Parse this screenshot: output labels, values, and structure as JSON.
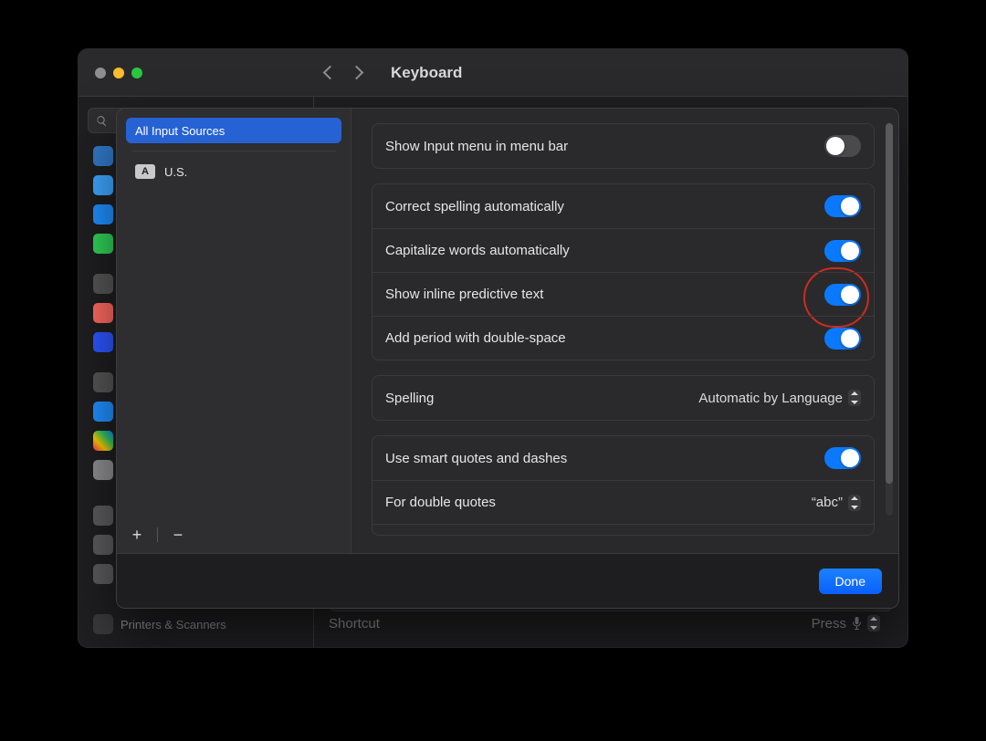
{
  "window": {
    "title": "Keyboard"
  },
  "sidebar": {
    "search_placeholder": "Search",
    "printers_label": "Printers & Scanners"
  },
  "modal": {
    "sources": {
      "all_label": "All Input Sources",
      "items": [
        {
          "flag": "A",
          "label": "U.S."
        }
      ]
    },
    "settings": {
      "show_input_menu": {
        "label": "Show Input menu in menu bar",
        "value": false
      },
      "correct_spelling": {
        "label": "Correct spelling automatically",
        "value": true
      },
      "capitalize_words": {
        "label": "Capitalize words automatically",
        "value": true
      },
      "inline_predictive": {
        "label": "Show inline predictive text",
        "value": true,
        "highlighted": true
      },
      "double_space_period": {
        "label": "Add period with double-space",
        "value": true
      },
      "spelling": {
        "label": "Spelling",
        "value": "Automatic by Language"
      },
      "smart_quotes": {
        "label": "Use smart quotes and dashes",
        "value": true
      },
      "double_quotes": {
        "label": "For double quotes",
        "value": "“abc”"
      }
    },
    "done_label": "Done"
  },
  "detail_footer": {
    "shortcut_label": "Shortcut",
    "press_label": "Press"
  }
}
